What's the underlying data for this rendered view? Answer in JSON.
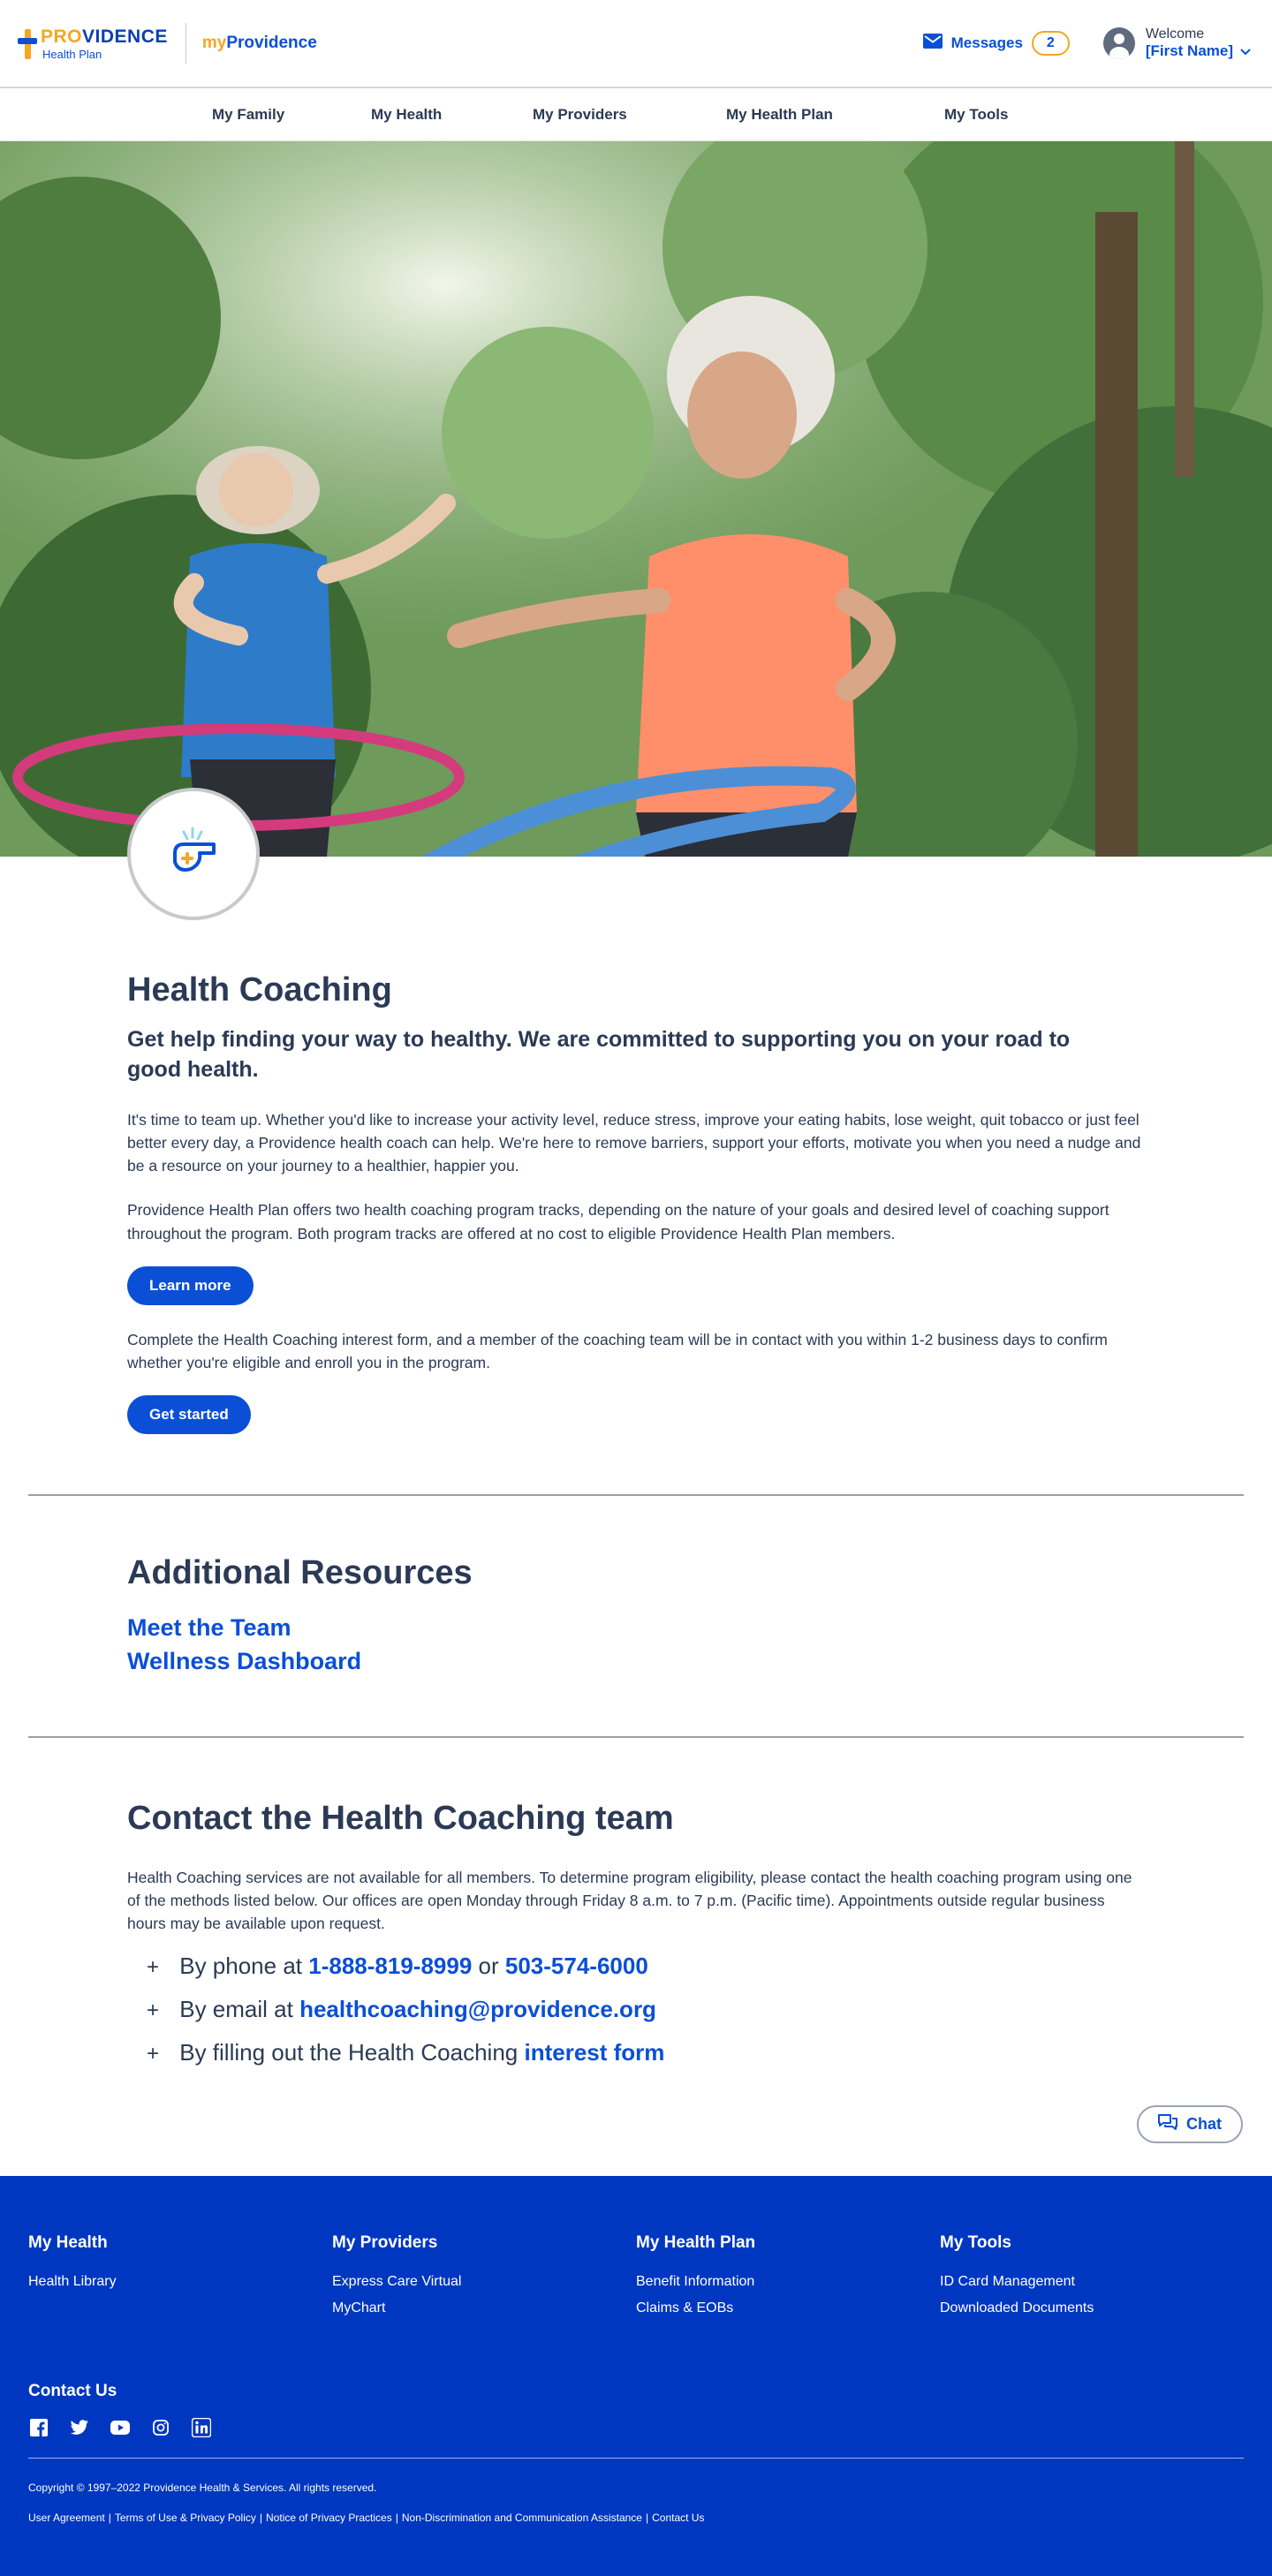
{
  "header": {
    "logo_word_prefix": "PROVIDENCE",
    "logo_subtitle": "Health Plan",
    "portal_prefix": "my",
    "portal_name": "Providence",
    "messages_label": "Messages",
    "messages_count": "2",
    "welcome_label": "Welcome",
    "user_name": "[First Name]"
  },
  "nav": {
    "items": [
      "My Family",
      "My Health",
      "My Providers",
      "My Health Plan",
      "My Tools"
    ]
  },
  "intro": {
    "title": "Health Coaching",
    "subtitle": "Get help finding your way to healthy. We are committed to supporting you on your road to good health.",
    "para1": "It's time to team up. Whether you'd like to increase your activity level, reduce stress, improve your eating habits, lose weight, quit tobacco or just feel better every day, a Providence health coach can help. We're here to remove barriers, support your efforts, motivate you when you need a nudge and be a resource on your journey to a healthier, happier you.",
    "para2": "Providence Health Plan offers two health coaching program tracks, depending on the nature of your goals and desired level of coaching support throughout the program. Both program tracks are offered at no cost to eligible Providence Health Plan members.",
    "learn_more": "Learn more",
    "para3": "Complete the Health Coaching interest form, and a member of the coaching team will be in contact with you within 1-2 business days to confirm whether you're eligible and enroll you in the program.",
    "get_started": "Get started"
  },
  "resources": {
    "title": "Additional Resources",
    "links": [
      "Meet the Team",
      "Wellness Dashboard"
    ]
  },
  "contact": {
    "title": "Contact the Health Coaching team",
    "para": "Health Coaching services are not available for all members. To determine program eligibility, please contact the health coaching program using one of the methods listed below. Our offices are open Monday through Friday 8 a.m. to 7 p.m. (Pacific time). Appointments outside regular business hours may be available upon request.",
    "phone_prefix": "By phone at",
    "phone1": "1-888-819-8999",
    "phone_or": "or",
    "phone2": "503-574-6000",
    "email_prefix": "By email at",
    "email": "healthcoaching@providence.org",
    "form_prefix": "By filling out the Health Coaching",
    "form_link": "interest form"
  },
  "chat": {
    "label": "Chat"
  },
  "footer": {
    "columns": [
      {
        "title": "My Health",
        "links": [
          "Health Library"
        ]
      },
      {
        "title": "My Providers",
        "links": [
          "Express Care Virtual",
          "MyChart"
        ]
      },
      {
        "title": "My Health Plan",
        "links": [
          "Benefit Information",
          "Claims & EOBs"
        ]
      },
      {
        "title": "My Tools",
        "links": [
          "ID Card Management",
          "Downloaded Documents"
        ]
      }
    ],
    "contact_us": "Contact Us",
    "socials": [
      "facebook-icon",
      "twitter-icon",
      "youtube-icon",
      "instagram-icon",
      "linkedin-icon"
    ],
    "copyright": "Copyright © 1997–2022 Providence Health & Services. All rights reserved.",
    "legal_links": [
      "User Agreement",
      "Terms of Use & Privacy Policy",
      "Notice of Privacy Practices",
      "Non-Discrimination and Communication Assistance",
      "Contact Us"
    ]
  },
  "colors": {
    "brand_blue": "#0a4fd6",
    "brand_orange": "#f5a623",
    "footer_blue": "#0037c1",
    "text_dark": "#2b3a55"
  }
}
